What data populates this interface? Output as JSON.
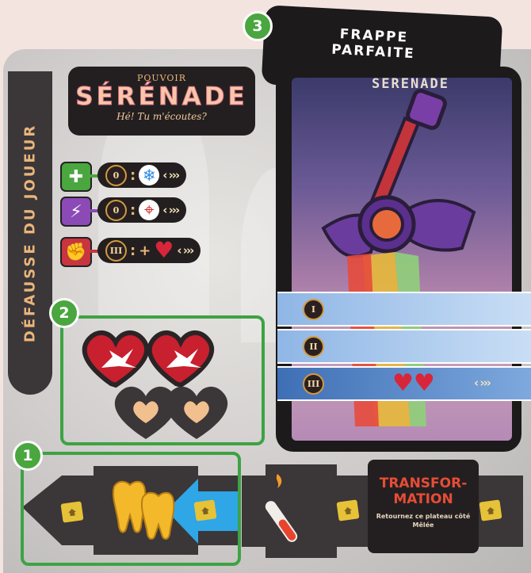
{
  "side_label": "DÉFAUSSE DU JOUEUR",
  "power": {
    "super": "POUVOIR",
    "name": "SÉRÉNADE",
    "quote": "Hé! Tu m'écoutes?"
  },
  "rows": [
    {
      "icon": "plus-icon",
      "color": "#4aa63f",
      "glyph": "✚",
      "coin": "0",
      "colon": ":",
      "plus": "",
      "effect_icon": "snowflake-icon",
      "effect_glyph": "❄",
      "arrows": "‹ ›››"
    },
    {
      "icon": "lightning-icon",
      "color": "#8b4ab6",
      "glyph": "⚡",
      "coin": "0",
      "colon": ":",
      "plus": "",
      "effect_icon": "crosshair-icon",
      "effect_glyph": "⌖",
      "arrows": "‹ ›››"
    },
    {
      "icon": "fist-icon",
      "color": "#c8343f",
      "glyph": "✊",
      "coin": "III",
      "colon": ":",
      "plus": "+",
      "effect_icon": "broken-heart-icon",
      "effect_glyph": "♥",
      "arrows": "‹ ›››"
    }
  ],
  "badges": [
    "1",
    "2",
    "3"
  ],
  "card": {
    "back_title": "FRAPPE PARFAITE",
    "title": "SERENADE",
    "levels": [
      "I",
      "II",
      "III"
    ],
    "level3_arrows": "‹ ›››"
  },
  "transform": {
    "title": "TRANSFOR-MATION",
    "subtitle": "Retournez ce plateau côté Mêlée"
  },
  "colors": {
    "zone": "#3da343",
    "arrow_blue": "#2fa6e6",
    "accent": "#e84c36"
  }
}
